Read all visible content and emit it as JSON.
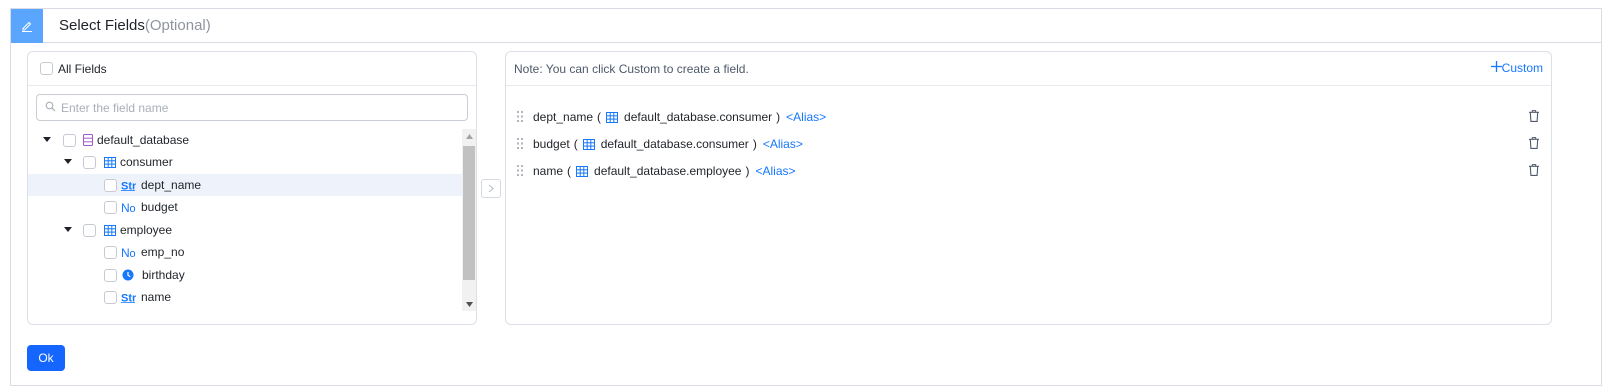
{
  "header": {
    "title": "Select Fields",
    "optional": "(Optional)"
  },
  "left": {
    "all_fields_label": "All Fields",
    "search_placeholder": "Enter the field name",
    "tree": {
      "database": "default_database",
      "tables": [
        {
          "name": "consumer",
          "fields": [
            {
              "name": "dept_name",
              "type": "Str"
            },
            {
              "name": "budget",
              "type": "No"
            }
          ]
        },
        {
          "name": "employee",
          "fields": [
            {
              "name": "emp_no",
              "type": "No"
            },
            {
              "name": "birthday",
              "type": "time"
            },
            {
              "name": "name",
              "type": "Str"
            }
          ]
        }
      ]
    }
  },
  "right": {
    "note": "Note: You can click Custom to create a field.",
    "custom_label": "Custom",
    "selected": [
      {
        "field": "dept_name",
        "table": "default_database.consumer",
        "alias": "<Alias>"
      },
      {
        "field": "budget",
        "table": "default_database.consumer",
        "alias": "<Alias>"
      },
      {
        "field": "name",
        "table": "default_database.employee",
        "alias": "<Alias>"
      }
    ]
  },
  "ok_label": "Ok",
  "colors": {
    "accent": "#1677ff",
    "ok_button": "#1466ff",
    "header_icon_bg": "#5aa6ff",
    "db_icon": "#a05ac8",
    "highlight_row": "#eef3fb"
  }
}
